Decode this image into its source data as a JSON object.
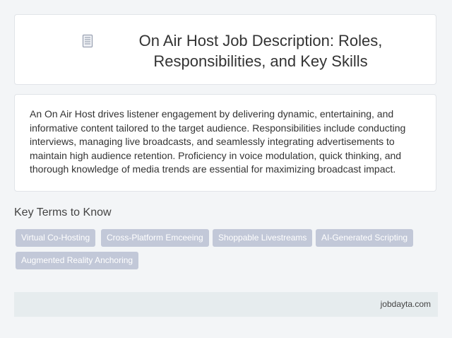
{
  "header": {
    "icon": "document-icon",
    "title": "On Air Host Job Description: Roles, Responsibilities, and Key Skills"
  },
  "description": "An On Air Host drives listener engagement by delivering dynamic, entertaining, and informative content tailored to the target audience. Responsibilities include conducting interviews, managing live broadcasts, and seamlessly integrating advertisements to maintain high audience retention. Proficiency in voice modulation, quick thinking, and thorough knowledge of media trends are essential for maximizing broadcast impact.",
  "key_terms": {
    "heading": "Key Terms to Know",
    "items": [
      "Virtual Co-Hosting",
      "Cross-Platform Emceeing",
      "Shoppable Livestreams",
      "AI-Generated Scripting",
      "Augmented Reality Anchoring"
    ]
  },
  "footer": {
    "site": "jobdayta.com"
  },
  "colors": {
    "background": "#f3f5f7",
    "tag": "#c2c8d8",
    "footer": "#e6ecee"
  }
}
